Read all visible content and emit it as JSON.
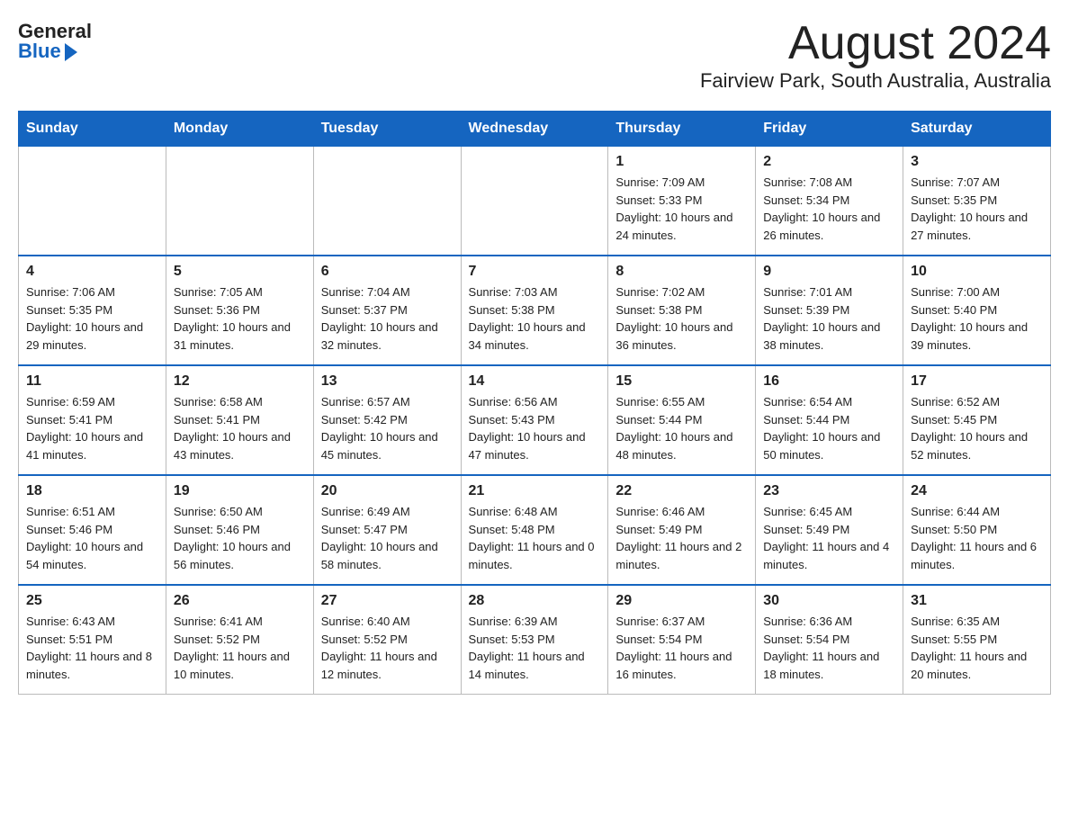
{
  "logo": {
    "general": "General",
    "blue": "Blue",
    "triangle": "▶"
  },
  "header": {
    "month_year": "August 2024",
    "location": "Fairview Park, South Australia, Australia"
  },
  "days_of_week": [
    "Sunday",
    "Monday",
    "Tuesday",
    "Wednesday",
    "Thursday",
    "Friday",
    "Saturday"
  ],
  "weeks": [
    [
      {
        "day": "",
        "info": ""
      },
      {
        "day": "",
        "info": ""
      },
      {
        "day": "",
        "info": ""
      },
      {
        "day": "",
        "info": ""
      },
      {
        "day": "1",
        "info": "Sunrise: 7:09 AM\nSunset: 5:33 PM\nDaylight: 10 hours and 24 minutes."
      },
      {
        "day": "2",
        "info": "Sunrise: 7:08 AM\nSunset: 5:34 PM\nDaylight: 10 hours and 26 minutes."
      },
      {
        "day": "3",
        "info": "Sunrise: 7:07 AM\nSunset: 5:35 PM\nDaylight: 10 hours and 27 minutes."
      }
    ],
    [
      {
        "day": "4",
        "info": "Sunrise: 7:06 AM\nSunset: 5:35 PM\nDaylight: 10 hours and 29 minutes."
      },
      {
        "day": "5",
        "info": "Sunrise: 7:05 AM\nSunset: 5:36 PM\nDaylight: 10 hours and 31 minutes."
      },
      {
        "day": "6",
        "info": "Sunrise: 7:04 AM\nSunset: 5:37 PM\nDaylight: 10 hours and 32 minutes."
      },
      {
        "day": "7",
        "info": "Sunrise: 7:03 AM\nSunset: 5:38 PM\nDaylight: 10 hours and 34 minutes."
      },
      {
        "day": "8",
        "info": "Sunrise: 7:02 AM\nSunset: 5:38 PM\nDaylight: 10 hours and 36 minutes."
      },
      {
        "day": "9",
        "info": "Sunrise: 7:01 AM\nSunset: 5:39 PM\nDaylight: 10 hours and 38 minutes."
      },
      {
        "day": "10",
        "info": "Sunrise: 7:00 AM\nSunset: 5:40 PM\nDaylight: 10 hours and 39 minutes."
      }
    ],
    [
      {
        "day": "11",
        "info": "Sunrise: 6:59 AM\nSunset: 5:41 PM\nDaylight: 10 hours and 41 minutes."
      },
      {
        "day": "12",
        "info": "Sunrise: 6:58 AM\nSunset: 5:41 PM\nDaylight: 10 hours and 43 minutes."
      },
      {
        "day": "13",
        "info": "Sunrise: 6:57 AM\nSunset: 5:42 PM\nDaylight: 10 hours and 45 minutes."
      },
      {
        "day": "14",
        "info": "Sunrise: 6:56 AM\nSunset: 5:43 PM\nDaylight: 10 hours and 47 minutes."
      },
      {
        "day": "15",
        "info": "Sunrise: 6:55 AM\nSunset: 5:44 PM\nDaylight: 10 hours and 48 minutes."
      },
      {
        "day": "16",
        "info": "Sunrise: 6:54 AM\nSunset: 5:44 PM\nDaylight: 10 hours and 50 minutes."
      },
      {
        "day": "17",
        "info": "Sunrise: 6:52 AM\nSunset: 5:45 PM\nDaylight: 10 hours and 52 minutes."
      }
    ],
    [
      {
        "day": "18",
        "info": "Sunrise: 6:51 AM\nSunset: 5:46 PM\nDaylight: 10 hours and 54 minutes."
      },
      {
        "day": "19",
        "info": "Sunrise: 6:50 AM\nSunset: 5:46 PM\nDaylight: 10 hours and 56 minutes."
      },
      {
        "day": "20",
        "info": "Sunrise: 6:49 AM\nSunset: 5:47 PM\nDaylight: 10 hours and 58 minutes."
      },
      {
        "day": "21",
        "info": "Sunrise: 6:48 AM\nSunset: 5:48 PM\nDaylight: 11 hours and 0 minutes."
      },
      {
        "day": "22",
        "info": "Sunrise: 6:46 AM\nSunset: 5:49 PM\nDaylight: 11 hours and 2 minutes."
      },
      {
        "day": "23",
        "info": "Sunrise: 6:45 AM\nSunset: 5:49 PM\nDaylight: 11 hours and 4 minutes."
      },
      {
        "day": "24",
        "info": "Sunrise: 6:44 AM\nSunset: 5:50 PM\nDaylight: 11 hours and 6 minutes."
      }
    ],
    [
      {
        "day": "25",
        "info": "Sunrise: 6:43 AM\nSunset: 5:51 PM\nDaylight: 11 hours and 8 minutes."
      },
      {
        "day": "26",
        "info": "Sunrise: 6:41 AM\nSunset: 5:52 PM\nDaylight: 11 hours and 10 minutes."
      },
      {
        "day": "27",
        "info": "Sunrise: 6:40 AM\nSunset: 5:52 PM\nDaylight: 11 hours and 12 minutes."
      },
      {
        "day": "28",
        "info": "Sunrise: 6:39 AM\nSunset: 5:53 PM\nDaylight: 11 hours and 14 minutes."
      },
      {
        "day": "29",
        "info": "Sunrise: 6:37 AM\nSunset: 5:54 PM\nDaylight: 11 hours and 16 minutes."
      },
      {
        "day": "30",
        "info": "Sunrise: 6:36 AM\nSunset: 5:54 PM\nDaylight: 11 hours and 18 minutes."
      },
      {
        "day": "31",
        "info": "Sunrise: 6:35 AM\nSunset: 5:55 PM\nDaylight: 11 hours and 20 minutes."
      }
    ]
  ]
}
